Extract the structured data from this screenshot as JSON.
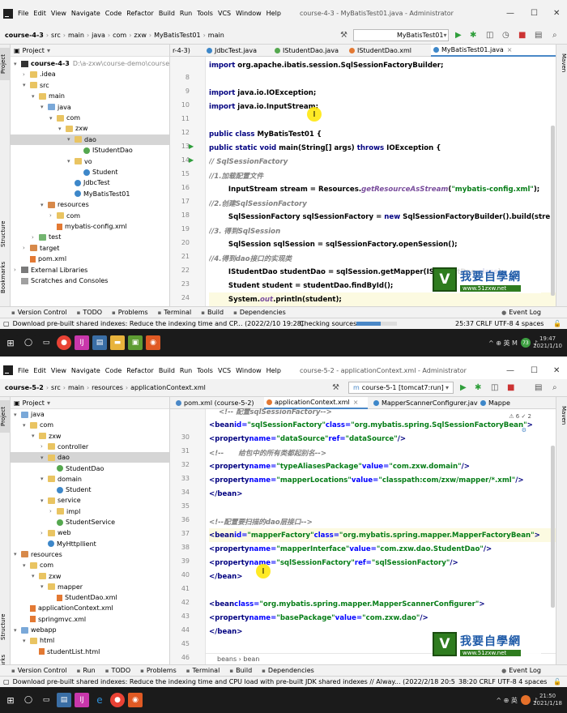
{
  "s1": {
    "menu": [
      "File",
      "Edit",
      "View",
      "Navigate",
      "Code",
      "Refactor",
      "Build",
      "Run",
      "Tools",
      "VCS",
      "Window",
      "Help"
    ],
    "window_title": "course-4-3 - MyBatisTest01.java - Administrator",
    "breadcrumbs": [
      "course-4-3",
      "src",
      "main",
      "java",
      "com",
      "zxw",
      "MyBatisTest01",
      "main"
    ],
    "run_config": "MyBatisTest01",
    "project_label": "Project",
    "tree": [
      {
        "d": 0,
        "a": "▾",
        "i": "mod",
        "t": "course-4-3",
        "x": "D:\\a-zxw\\course-demo\\course"
      },
      {
        "d": 1,
        "a": "›",
        "i": "fold",
        "t": ".idea"
      },
      {
        "d": 1,
        "a": "▾",
        "i": "fold",
        "t": "src"
      },
      {
        "d": 2,
        "a": "▾",
        "i": "fold",
        "t": "main"
      },
      {
        "d": 3,
        "a": "▾",
        "i": "fold src",
        "t": "java"
      },
      {
        "d": 4,
        "a": "▾",
        "i": "fold",
        "t": "com"
      },
      {
        "d": 5,
        "a": "▾",
        "i": "fold",
        "t": "zxw"
      },
      {
        "d": 6,
        "a": "▾",
        "i": "fold",
        "t": "dao",
        "sel": true
      },
      {
        "d": 7,
        "a": "",
        "i": "intf",
        "t": "IStudentDao"
      },
      {
        "d": 6,
        "a": "▾",
        "i": "fold",
        "t": "vo"
      },
      {
        "d": 7,
        "a": "",
        "i": "cls",
        "t": "Student"
      },
      {
        "d": 6,
        "a": "",
        "i": "cls",
        "t": "JdbcTest"
      },
      {
        "d": 6,
        "a": "",
        "i": "cls",
        "t": "MyBatisTest01"
      },
      {
        "d": 3,
        "a": "▾",
        "i": "fold orange",
        "t": "resources"
      },
      {
        "d": 4,
        "a": "›",
        "i": "fold",
        "t": "com"
      },
      {
        "d": 4,
        "a": "",
        "i": "xml",
        "t": "mybatis-config.xml"
      },
      {
        "d": 2,
        "a": "›",
        "i": "fold green",
        "t": "test"
      },
      {
        "d": 1,
        "a": "›",
        "i": "fold orange",
        "t": "target"
      },
      {
        "d": 1,
        "a": "",
        "i": "xml",
        "t": "pom.xml"
      },
      {
        "d": 0,
        "a": "›",
        "i": "lib",
        "t": "External Libraries"
      },
      {
        "d": 0,
        "a": "",
        "i": "scr",
        "t": "Scratches and Consoles"
      }
    ],
    "tabs": [
      "r-4-3)",
      "JdbcTest.java",
      "IStudentDao.java",
      "IStudentDao.xml",
      "MyBatisTest01.java"
    ],
    "lines": [
      {
        "n": "8",
        "h": "<span class=\"kw\">import</span> org.apache.ibatis.session.SqlSessionFactoryBuilder;"
      },
      {
        "n": "9",
        "h": ""
      },
      {
        "n": "10",
        "h": "<span class=\"kw\">import</span> java.io.IOException;"
      },
      {
        "n": "11",
        "h": "<span class=\"kw\">import</span> java.io.InputStream;"
      },
      {
        "n": "12",
        "h": ""
      },
      {
        "n": "13",
        "r": true,
        "h": "<span class=\"kw\">public class</span> MyBatisTest01 {"
      },
      {
        "n": "14",
        "r": true,
        "h": "    <span class=\"kw\">public static void</span> main(String[] args) <span class=\"kw\">throws</span> IOException {"
      },
      {
        "n": "15",
        "h": "        <span class=\"cm\">// SqlSessionFactory</span>"
      },
      {
        "n": "16",
        "h": "        <span class=\"cm\">//1.加载配置文件</span>"
      },
      {
        "n": "17",
        "h": "        InputStream stream = Resources.<span class=\"mt\">getResourceAsStream</span>(<span class=\"st\">\"mybatis-config.xml\"</span>);"
      },
      {
        "n": "18",
        "h": "        <span class=\"cm\">//2.创建SqlSessionFactory</span>"
      },
      {
        "n": "19",
        "h": "        SqlSessionFactory sqlSessionFactory = <span class=\"kw\">new</span> SqlSessionFactoryBuilder().build(stre"
      },
      {
        "n": "20",
        "h": "        <span class=\"cm\">//3. 得到SqlSession</span>"
      },
      {
        "n": "21",
        "h": "        SqlSession sqlSession = sqlSessionFactory.openSession();"
      },
      {
        "n": "22",
        "h": "        <span class=\"cm\">//4.得到dao接口的实现类</span>"
      },
      {
        "n": "23",
        "h": "        IStudentDao studentDao = sqlSession.getMapper(IStudentDao.<span class=\"kw\">class</span>);"
      },
      {
        "n": "24",
        "h": "        Student student = studentDao.findById();"
      },
      {
        "n": "25",
        "c": true,
        "h": "        System.<span class=\"mt\">out</span>.println(student);"
      },
      {
        "n": "26",
        "h": "    }"
      }
    ],
    "toolwindows": [
      "Version Control",
      "TODO",
      "Problems",
      "Terminal",
      "Build",
      "Dependencies"
    ],
    "event_log": "Event Log",
    "status_msg": "Download pre-built shared indexes: Reduce the indexing time and CP... (2022/2/10 19:28)",
    "status_mid": "Checking sources",
    "status_right": "25:37   CRLF   UTF-8   4 spaces",
    "tray": "^  ⊕  英  M",
    "time": "19:47",
    "date": "2021/1/10",
    "watermark": {
      "title": "我要自學網",
      "url": "www.51zxw.net"
    }
  },
  "s2": {
    "menu": [
      "File",
      "Edit",
      "View",
      "Navigate",
      "Code",
      "Refactor",
      "Build",
      "Run",
      "Tools",
      "VCS",
      "Window",
      "Help"
    ],
    "window_title": "course-5-2 - applicationContext.xml - Administrator",
    "breadcrumbs": [
      "course-5-2",
      "src",
      "main",
      "resources",
      "applicationContext.xml"
    ],
    "run_config": "course-5-1 [tomcat7:run]",
    "project_label": "Project",
    "tree": [
      {
        "d": 4,
        "a": "▾",
        "i": "fold src",
        "t": "java"
      },
      {
        "d": 5,
        "a": "▾",
        "i": "fold",
        "t": "com"
      },
      {
        "d": 6,
        "a": "▾",
        "i": "fold",
        "t": "zxw"
      },
      {
        "d": 7,
        "a": "›",
        "i": "fold",
        "t": "controller"
      },
      {
        "d": 7,
        "a": "▾",
        "i": "fold",
        "t": "dao",
        "sel": true
      },
      {
        "d": 8,
        "a": "",
        "i": "intf",
        "t": "StudentDao"
      },
      {
        "d": 7,
        "a": "▾",
        "i": "fold",
        "t": "domain"
      },
      {
        "d": 8,
        "a": "",
        "i": "cls",
        "t": "Student"
      },
      {
        "d": 7,
        "a": "▾",
        "i": "fold",
        "t": "service"
      },
      {
        "d": 8,
        "a": "›",
        "i": "fold",
        "t": "impl"
      },
      {
        "d": 8,
        "a": "",
        "i": "intf",
        "t": "StudentService"
      },
      {
        "d": 7,
        "a": "›",
        "i": "fold",
        "t": "web"
      },
      {
        "d": 7,
        "a": "",
        "i": "cls",
        "t": "MyHttpllient"
      },
      {
        "d": 4,
        "a": "▾",
        "i": "fold orange",
        "t": "resources"
      },
      {
        "d": 5,
        "a": "▾",
        "i": "fold",
        "t": "com"
      },
      {
        "d": 6,
        "a": "▾",
        "i": "fold",
        "t": "zxw"
      },
      {
        "d": 7,
        "a": "▾",
        "i": "fold",
        "t": "mapper"
      },
      {
        "d": 8,
        "a": "",
        "i": "xml",
        "t": "StudentDao.xml"
      },
      {
        "d": 5,
        "a": "",
        "i": "xml",
        "t": "applicationContext.xml"
      },
      {
        "d": 5,
        "a": "",
        "i": "xml",
        "t": "springmvc.xml"
      },
      {
        "d": 4,
        "a": "▾",
        "i": "fold blue",
        "t": "webapp"
      },
      {
        "d": 5,
        "a": "▾",
        "i": "fold",
        "t": "html"
      },
      {
        "d": 6,
        "a": "",
        "i": "xml",
        "t": "studentList.html"
      }
    ],
    "tabs": [
      "pom.xml (course-5-2)",
      "applicationContext.xml",
      "MapperScannerConfigurer.java",
      "Mappe"
    ],
    "lines": [
      {
        "n": "",
        "h": "<span class=\"xc\">    &lt;!-- 配置sqlSessionFactory--&gt;</span>"
      },
      {
        "n": "30",
        "h": "    <span class=\"tg\">&lt;bean</span> <span class=\"at\">id=</span><span class=\"av\">\"sqlSessionFactory\"</span> <span class=\"at\">class=</span><span class=\"av\">\"org.mybatis.spring.SqlSessionFactoryBean\"</span><span class=\"tg\">&gt;</span>"
      },
      {
        "n": "31",
        "h": "        <span class=\"tg\">&lt;property</span> <span class=\"at\">name=</span><span class=\"av\">\"dataSource\"</span> <span class=\"at\">ref=</span><span class=\"av\">\"dataSource\"</span><span class=\"tg\">/&gt;</span>"
      },
      {
        "n": "32",
        "h": "        <span class=\"xc\">&lt;!--      给包中的所有类都起别名--&gt;</span>"
      },
      {
        "n": "33",
        "h": "        <span class=\"tg\">&lt;property</span> <span class=\"at\">name=</span><span class=\"av\">\"typeAliasesPackage\"</span> <span class=\"at\">value=</span><span class=\"av\">\"com.zxw.domain\"</span> <span class=\"tg\">/&gt;</span>"
      },
      {
        "n": "34",
        "h": "        <span class=\"tg\">&lt;property</span> <span class=\"at\">name=</span><span class=\"av\">\"mapperLocations\"</span> <span class=\"at\">value=</span><span class=\"av\">\"classpath:com/zxw/mapper/*.xml\"</span><span class=\"tg\">/&gt;</span>"
      },
      {
        "n": "35",
        "h": "    <span class=\"tg\">&lt;/bean&gt;</span>"
      },
      {
        "n": "36",
        "h": ""
      },
      {
        "n": "37",
        "h": "    <span class=\"xc\">&lt;!--配置要扫描的dao层接口--&gt;</span>"
      },
      {
        "n": "38",
        "c": true,
        "h": "    <span class=\"tg\">&lt;bean</span> <span class=\"at\">id=</span><span class=\"av\">\"mapperFactory\"</span> <span class=\"at\">class=</span><span class=\"av\">\"org.mybatis.spring.mapper.MapperFactoryBean\"</span><span class=\"tg\">&gt;</span>"
      },
      {
        "n": "39",
        "h": "        <span class=\"tg\">&lt;property</span> <span class=\"at\">name=</span><span class=\"av\">\"mapperInterface\"</span> <span class=\"at\">value=</span><span class=\"av\">\"com.zxw.dao.StudentDao\"</span><span class=\"tg\">/&gt;</span>"
      },
      {
        "n": "40",
        "h": "        <span class=\"tg\">&lt;property</span> <span class=\"at\">name=</span><span class=\"av\">\"sqlSessionFactory\"</span> <span class=\"at\">ref=</span><span class=\"av\">\"sqlSessionFactory\"</span><span class=\"tg\">/&gt;</span>"
      },
      {
        "n": "41",
        "h": "    <span class=\"tg\">&lt;/bean&gt;</span>"
      },
      {
        "n": "42",
        "h": ""
      },
      {
        "n": "43",
        "h": "    <span class=\"tg\">&lt;bean</span> <span class=\"at\">class=</span><span class=\"av\">\"org.mybatis.spring.mapper.MapperScannerConfigurer\"</span><span class=\"tg\">&gt;</span>"
      },
      {
        "n": "44",
        "h": "        <span class=\"tg\">&lt;property</span> <span class=\"at\">name=</span><span class=\"av\">\"basePackage\"</span> <span class=\"at\">value=</span><span class=\"av\">\"com.zxw.dao\"</span><span class=\"tg\">/&gt;</span>"
      },
      {
        "n": "45",
        "h": "    <span class=\"tg\">&lt;/bean&gt;</span>"
      },
      {
        "n": "46",
        "h": ""
      }
    ],
    "editor_crumb": "beans  ›  bean",
    "inspect": "⚠ 6  ✓ 2",
    "toolwindows": [
      "Version Control",
      "Run",
      "TODO",
      "Problems",
      "Terminal",
      "Build",
      "Dependencies"
    ],
    "event_log": "Event Log",
    "status_msg": "Download pre-built shared indexes: Reduce the indexing time and CPU load with pre-built JDK shared indexes // Alway... (2022/2/18 20:56)",
    "status_right": "38:20   CRLF   UTF-8   4 spaces",
    "tray": "^  ⊕  英",
    "time": "21:50",
    "date": "2021/1/18",
    "watermark": {
      "title": "我要自學網",
      "url": "www.51zxw.net"
    }
  }
}
